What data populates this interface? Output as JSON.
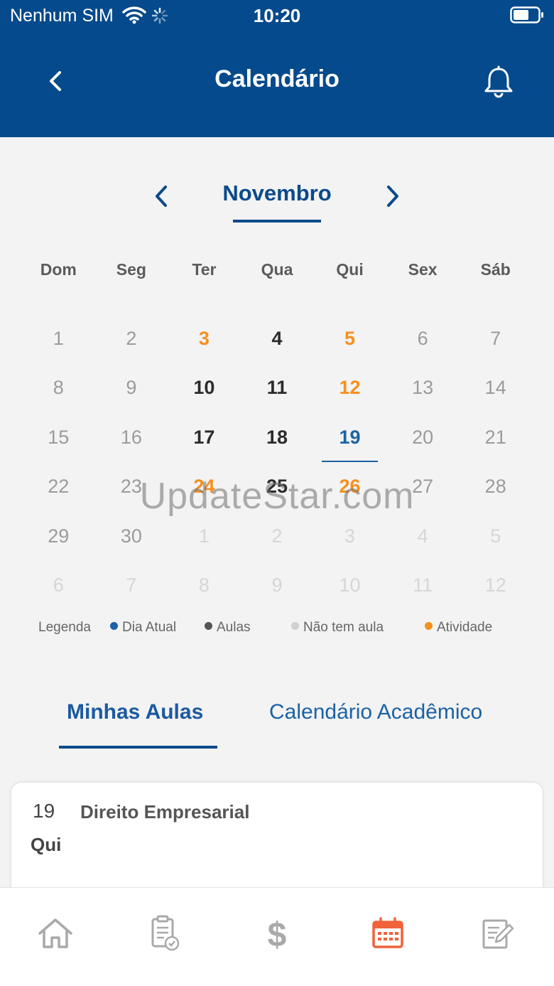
{
  "status_bar": {
    "carrier": "Nenhum SIM",
    "time": "10:20"
  },
  "header": {
    "title": "Calendário",
    "back_icon": "chevron-left-icon",
    "bell_icon": "bell-icon"
  },
  "calendar": {
    "month": "Novembro",
    "weekdays": [
      "Dom",
      "Seg",
      "Ter",
      "Qua",
      "Qui",
      "Sex",
      "Sáb"
    ],
    "days": [
      {
        "n": "1",
        "t": "none"
      },
      {
        "n": "2",
        "t": "none"
      },
      {
        "n": "3",
        "t": "act"
      },
      {
        "n": "4",
        "t": "class"
      },
      {
        "n": "5",
        "t": "act"
      },
      {
        "n": "6",
        "t": "none"
      },
      {
        "n": "7",
        "t": "none"
      },
      {
        "n": "8",
        "t": "none"
      },
      {
        "n": "9",
        "t": "none"
      },
      {
        "n": "10",
        "t": "class"
      },
      {
        "n": "11",
        "t": "class"
      },
      {
        "n": "12",
        "t": "act"
      },
      {
        "n": "13",
        "t": "none"
      },
      {
        "n": "14",
        "t": "none"
      },
      {
        "n": "15",
        "t": "none"
      },
      {
        "n": "16",
        "t": "none"
      },
      {
        "n": "17",
        "t": "class"
      },
      {
        "n": "18",
        "t": "class"
      },
      {
        "n": "19",
        "t": "today"
      },
      {
        "n": "20",
        "t": "none"
      },
      {
        "n": "21",
        "t": "none"
      },
      {
        "n": "22",
        "t": "none"
      },
      {
        "n": "23",
        "t": "none"
      },
      {
        "n": "24",
        "t": "act"
      },
      {
        "n": "25",
        "t": "class"
      },
      {
        "n": "26",
        "t": "act"
      },
      {
        "n": "27",
        "t": "none"
      },
      {
        "n": "28",
        "t": "none"
      },
      {
        "n": "29",
        "t": "none"
      },
      {
        "n": "30",
        "t": "none"
      },
      {
        "n": "1",
        "t": "other"
      },
      {
        "n": "2",
        "t": "other"
      },
      {
        "n": "3",
        "t": "other"
      },
      {
        "n": "4",
        "t": "other"
      },
      {
        "n": "5",
        "t": "other"
      },
      {
        "n": "6",
        "t": "other"
      },
      {
        "n": "7",
        "t": "other"
      },
      {
        "n": "8",
        "t": "other"
      },
      {
        "n": "9",
        "t": "other"
      },
      {
        "n": "10",
        "t": "other"
      },
      {
        "n": "11",
        "t": "other"
      },
      {
        "n": "12",
        "t": "other"
      }
    ]
  },
  "legend": {
    "label": "Legenda",
    "items": [
      {
        "label": "Dia Atual",
        "color": "#1b62a6"
      },
      {
        "label": "Aulas",
        "color": "#555555"
      },
      {
        "label": "Não tem aula",
        "color": "#d0d0d0"
      },
      {
        "label": "Atividade",
        "color": "#f5901e"
      }
    ]
  },
  "tabs": {
    "active": "Minhas Aulas",
    "other": "Calendário Acadêmico"
  },
  "class_card": {
    "day": "19",
    "weekday": "Qui",
    "subject": "Direito Empresarial"
  },
  "watermark": "UpdateStar.com",
  "bottom_nav": [
    {
      "icon": "home-icon"
    },
    {
      "icon": "clipboard-check-icon"
    },
    {
      "icon": "dollar-icon"
    },
    {
      "icon": "calendar-icon",
      "active": true
    },
    {
      "icon": "edit-document-icon"
    }
  ],
  "colors": {
    "header_bg": "#044a8c",
    "active_nav": "#f0623a",
    "inactive_nav": "#a9a9a9"
  }
}
